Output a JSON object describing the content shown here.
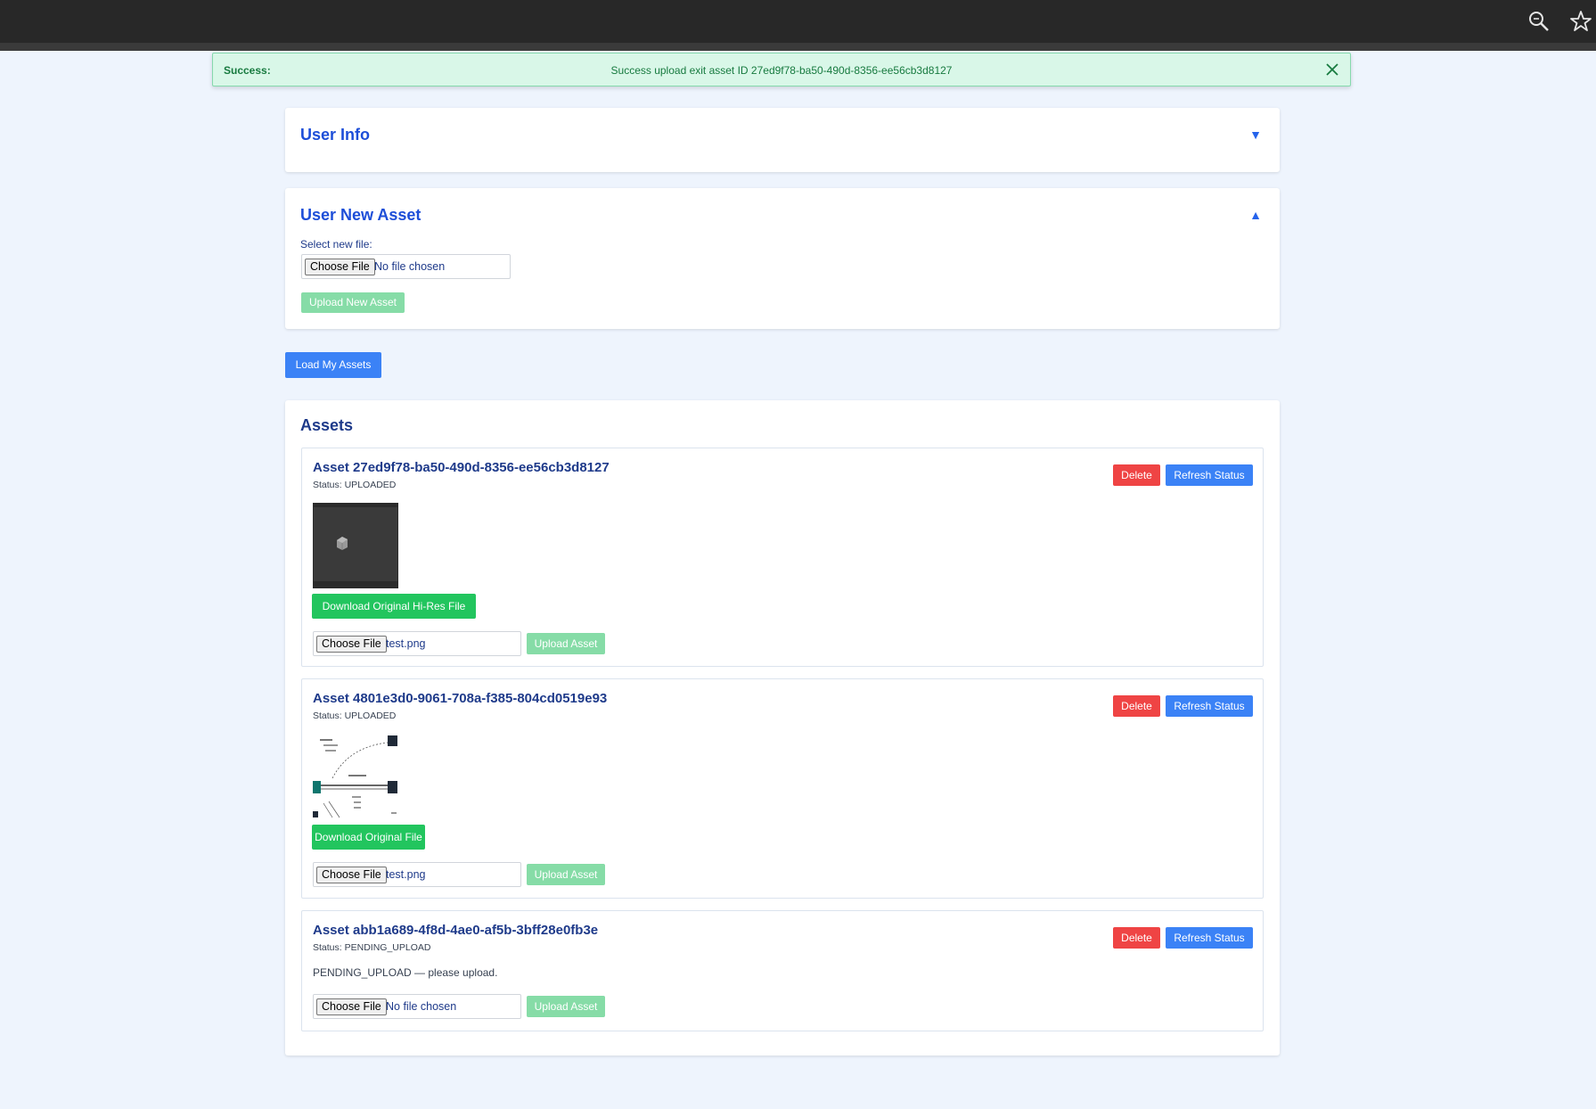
{
  "toast": {
    "title": "Success:",
    "message": "Success upload exit asset ID 27ed9f78-ba50-490d-8356-ee56cb3d8127"
  },
  "browser": {
    "icons": [
      "zoom-icon",
      "star-icon"
    ]
  },
  "user_info": {
    "title": "User Info",
    "caret": "▼"
  },
  "new_asset": {
    "title": "User New Asset",
    "caret": "▲",
    "select_label": "Select new file:",
    "choose_label": "Choose File",
    "file_name": "No file chosen",
    "upload_label": "Upload New Asset"
  },
  "load_button": "Load My Assets",
  "assets_section": {
    "title": "Assets",
    "items": [
      {
        "title": "Asset 27ed9f78-ba50-490d-8356-ee56cb3d8127",
        "status": "Status: UPLOADED",
        "thumbnail": "dark-3d-viewport-thumbnail",
        "download_label": "Download Original Hi-Res File",
        "choose_label": "Choose File",
        "file_name": "test.png",
        "upload_label": "Upload Asset",
        "delete_label": "Delete",
        "refresh_label": "Refresh Status"
      },
      {
        "title": "Asset 4801e3d0-9061-708a-f385-804cd0519e93",
        "status": "Status: UPLOADED",
        "thumbnail": "diagram-thumbnail",
        "download_label": "Download Original File",
        "choose_label": "Choose File",
        "file_name": "test.png",
        "upload_label": "Upload Asset",
        "delete_label": "Delete",
        "refresh_label": "Refresh Status"
      },
      {
        "title": "Asset abb1a689-4f8d-4ae0-af5b-3bff28e0fb3e",
        "status": "Status: PENDING_UPLOAD",
        "pending_text": "PENDING_UPLOAD — please upload.",
        "choose_label": "Choose File",
        "file_name": "No file chosen",
        "upload_label": "Upload Asset",
        "delete_label": "Delete",
        "refresh_label": "Refresh Status"
      }
    ]
  }
}
